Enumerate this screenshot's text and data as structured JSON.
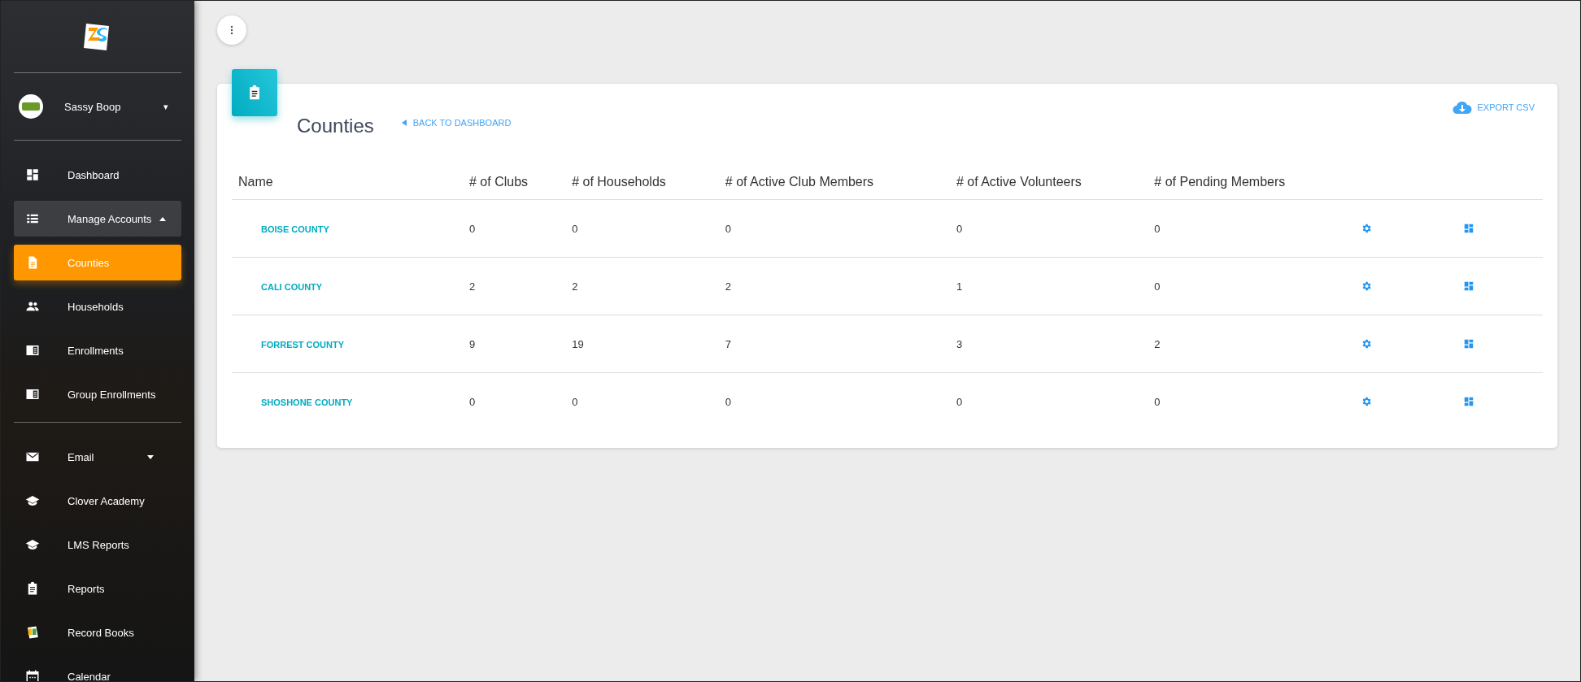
{
  "sidebar": {
    "user": {
      "name": "Sassy Boop",
      "caret": "▾"
    },
    "sections": [
      [
        {
          "label": "Dashboard",
          "kind": "item",
          "selected": false
        },
        {
          "label": "Manage Accounts",
          "kind": "group",
          "expanded": true,
          "selected": false
        },
        {
          "label": "Counties",
          "kind": "item",
          "selected": true
        },
        {
          "label": "Households",
          "kind": "item",
          "selected": false
        },
        {
          "label": "Enrollments",
          "kind": "item",
          "selected": false
        },
        {
          "label": "Group Enrollments",
          "kind": "item",
          "selected": false
        }
      ],
      [
        {
          "label": "Email",
          "kind": "group",
          "expanded": false,
          "selected": false
        },
        {
          "label": "Clover Academy",
          "kind": "item",
          "selected": false
        },
        {
          "label": "LMS Reports",
          "kind": "item",
          "selected": false
        },
        {
          "label": "Reports",
          "kind": "item",
          "selected": false
        },
        {
          "label": "Record Books",
          "kind": "item",
          "selected": false
        },
        {
          "label": "Calendar",
          "kind": "item",
          "selected": false
        }
      ]
    ]
  },
  "page": {
    "title": "Counties",
    "back_link": "BACK TO DASHBOARD",
    "export": "EXPORT CSV"
  },
  "table": {
    "columns": [
      "Name",
      "# of Clubs",
      "# of Households",
      "# of Active Club Members",
      "# of Active Volunteers",
      "# of Pending Members"
    ],
    "rows": [
      {
        "name": "BOISE COUNTY",
        "values": [
          "0",
          "0",
          "0",
          "0",
          "0"
        ]
      },
      {
        "name": "CALI COUNTY",
        "values": [
          "2",
          "2",
          "2",
          "1",
          "0"
        ]
      },
      {
        "name": "FORREST COUNTY",
        "values": [
          "9",
          "19",
          "7",
          "3",
          "2"
        ]
      },
      {
        "name": "SHOSHONE COUNTY",
        "values": [
          "0",
          "0",
          "0",
          "0",
          "0"
        ]
      }
    ]
  }
}
